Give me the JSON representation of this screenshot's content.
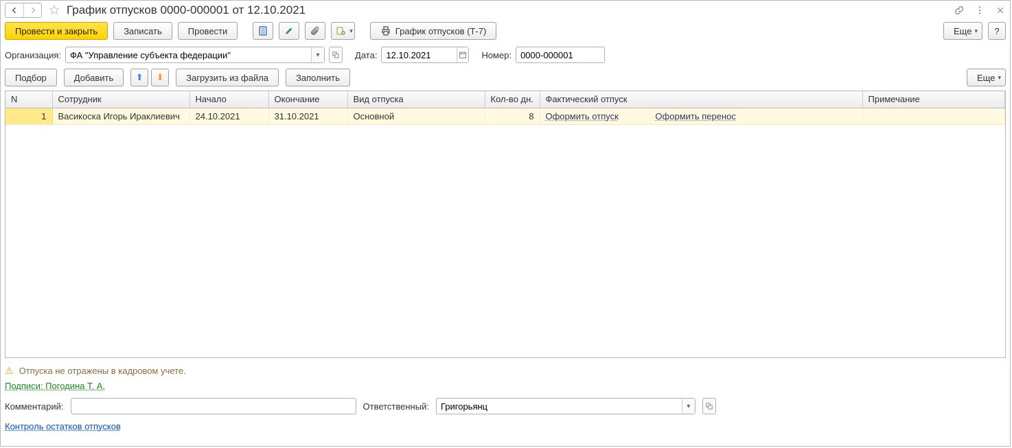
{
  "title": "График отпусков 0000-000001 от 12.10.2021",
  "toolbar": {
    "post_close": "Провести и закрыть",
    "save": "Записать",
    "post": "Провести",
    "print_t7": "График отпусков (Т-7)",
    "more": "Еще",
    "help": "?"
  },
  "form": {
    "org_label": "Организация:",
    "org_value": "ФА \"Управление субъекта федерации\"",
    "date_label": "Дата:",
    "date_value": "12.10.2021",
    "num_label": "Номер:",
    "num_value": "0000-000001"
  },
  "sub": {
    "select": "Подбор",
    "add": "Добавить",
    "load_file": "Загрузить из файла",
    "fill": "Заполнить",
    "more": "Еще"
  },
  "table": {
    "headers": {
      "n": "N",
      "employee": "Сотрудник",
      "start": "Начало",
      "end": "Окончание",
      "type": "Вид отпуска",
      "days": "Кол-во дн.",
      "actual": "Фактический отпуск",
      "note": "Примечание"
    },
    "rows": [
      {
        "n": "1",
        "employee": "Васикоска Игорь Ираклиевич",
        "start": "24.10.2021",
        "end": "31.10.2021",
        "type": "Основной",
        "days": "8",
        "link1": "Оформить отпуск",
        "link2": "Оформить перенос",
        "note": ""
      }
    ]
  },
  "status": {
    "warning": "Отпуска не отражены в кадровом учете."
  },
  "signatures": "Подписи: Погодина Т. А.",
  "footer": {
    "comment_label": "Комментарий:",
    "comment_value": "",
    "resp_label": "Ответственный:",
    "resp_value": "Григорьянц"
  },
  "control_link": "Контроль остатков отпусков"
}
